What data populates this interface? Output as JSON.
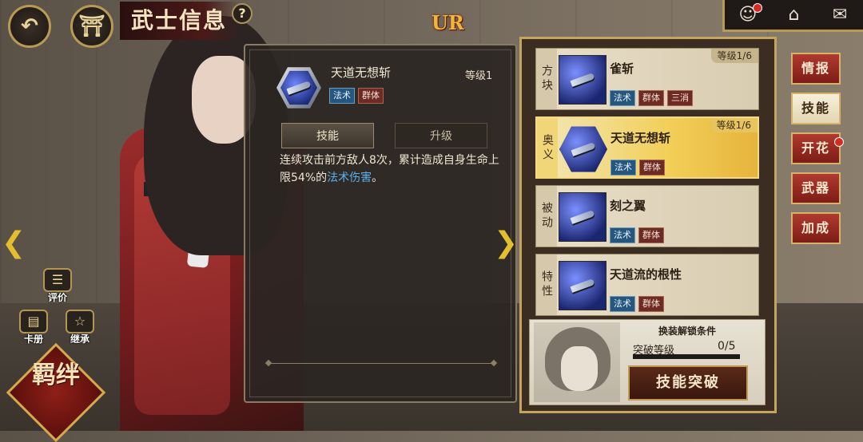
{
  "header": {
    "title": "武士信息",
    "back_icon": "back-arrow-icon",
    "home_icon": "home-icon",
    "help_label": "?",
    "rarity_badge": "UR",
    "right_icons": [
      "character-icon",
      "guild-icon",
      "mail-icon"
    ]
  },
  "skill_detail": {
    "name": "天道无想斩",
    "level": "等级1",
    "tags": [
      "法术",
      "群体"
    ],
    "tabs": [
      "技能",
      "升级"
    ],
    "description_prefix": "连续攻击前方敌人8次，累计造成自身生命上限54%的",
    "description_highlight": "法术伤害",
    "description_suffix": "。"
  },
  "skills": [
    {
      "category": "方块",
      "name": "雀斩",
      "level": "等级1/6",
      "tags": [
        "法术",
        "群体",
        "三消"
      ],
      "selected": false
    },
    {
      "category": "奥义",
      "name": "天道无想斩",
      "level": "等级1/6",
      "tags": [
        "法术",
        "群体"
      ],
      "selected": true
    },
    {
      "category": "被动",
      "name": "刻之翼",
      "level": "",
      "tags": [
        "法术",
        "群体"
      ],
      "selected": false
    },
    {
      "category": "特性",
      "name": "天道流的根性",
      "level": "",
      "tags": [
        "法术",
        "群体"
      ],
      "selected": false
    }
  ],
  "unlock": {
    "title": "换装解锁条件",
    "condition_label": "突破等级",
    "condition_value": "0/5",
    "progress": 0,
    "button_label": "技能突破"
  },
  "right_tabs": [
    "情报",
    "技能",
    "开花",
    "武器",
    "加成"
  ],
  "left_buttons": {
    "review": "评价",
    "cards": "卡册",
    "inherit": "继承",
    "bond": "羁绊"
  },
  "colors": {
    "accent_gold": "#c4a45e",
    "tab_red": "#b03a2f",
    "highlight_blue": "#5ab1f0"
  }
}
